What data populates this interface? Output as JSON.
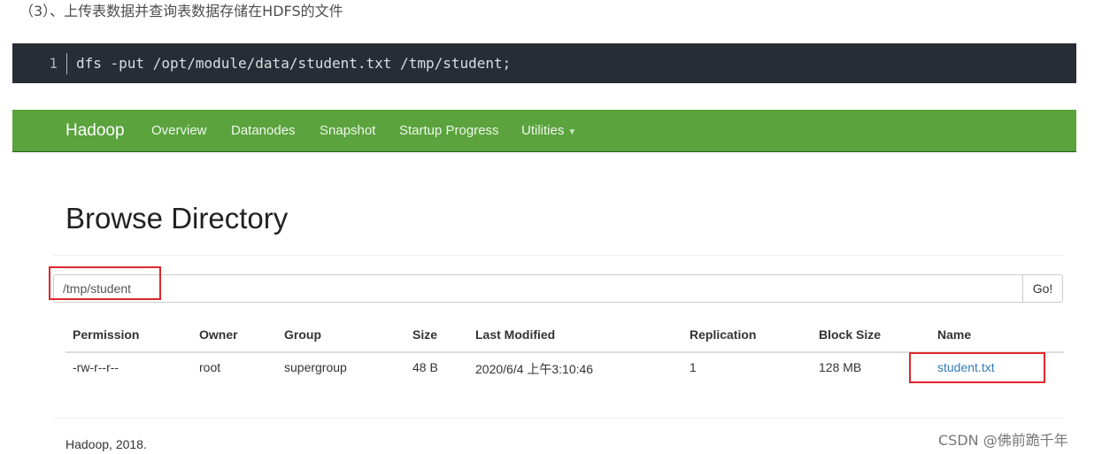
{
  "caption": "（3）、上传表数据并查询表数据存储在HDFS的文件",
  "code": {
    "line_number": "1",
    "text": "dfs -put /opt/module/data/student.txt /tmp/student;"
  },
  "navbar": {
    "brand": "Hadoop",
    "items": [
      "Overview",
      "Datanodes",
      "Snapshot",
      "Startup Progress",
      "Utilities"
    ]
  },
  "page": {
    "title": "Browse Directory"
  },
  "path_bar": {
    "value": "/tmp/student",
    "go_label": "Go!"
  },
  "table": {
    "columns": [
      "Permission",
      "Owner",
      "Group",
      "Size",
      "Last Modified",
      "Replication",
      "Block Size",
      "Name"
    ],
    "rows": [
      [
        "-rw-r--r--",
        "root",
        "supergroup",
        "48 B",
        "2020/6/4 上午3:10:46",
        "1",
        "128 MB",
        "student.txt"
      ]
    ]
  },
  "footer": "Hadoop, 2018.",
  "watermark": "CSDN @佛前跪千年",
  "colors": {
    "navbar": "#5aa33d",
    "code_bg": "#282c34",
    "highlight": "#e0262c",
    "link": "#337ab7"
  },
  "icons": {
    "dropdown": "caret-down-icon"
  }
}
